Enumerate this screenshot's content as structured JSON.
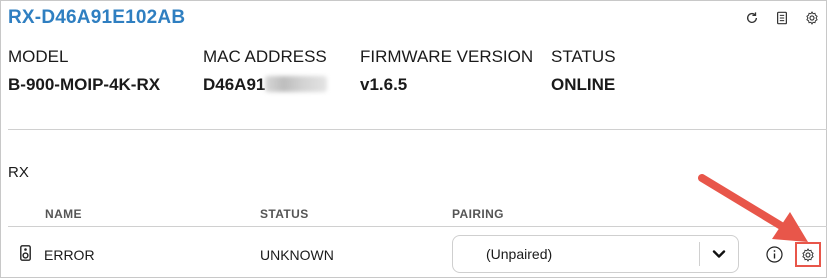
{
  "device": {
    "id": "RX-D46A91E102AB"
  },
  "toolbar": {
    "icons": [
      "refresh-icon",
      "document-icon",
      "gear-icon"
    ]
  },
  "info": {
    "model_label": "MODEL",
    "model_value": "B-900-MOIP-4K-RX",
    "mac_label": "MAC ADDRESS",
    "mac_value": "D46A91",
    "firmware_label": "FIRMWARE VERSION",
    "firmware_value": "v1.6.5",
    "status_label": "STATUS",
    "status_value": "ONLINE"
  },
  "rx": {
    "title": "RX",
    "columns": {
      "name": "NAME",
      "status": "STATUS",
      "pairing": "PAIRING"
    },
    "rows": [
      {
        "name": "ERROR",
        "status": "UNKNOWN",
        "pairing": "(Unpaired)"
      }
    ]
  },
  "colors": {
    "accent": "#2f7fc1",
    "highlight": "#e8564a"
  }
}
